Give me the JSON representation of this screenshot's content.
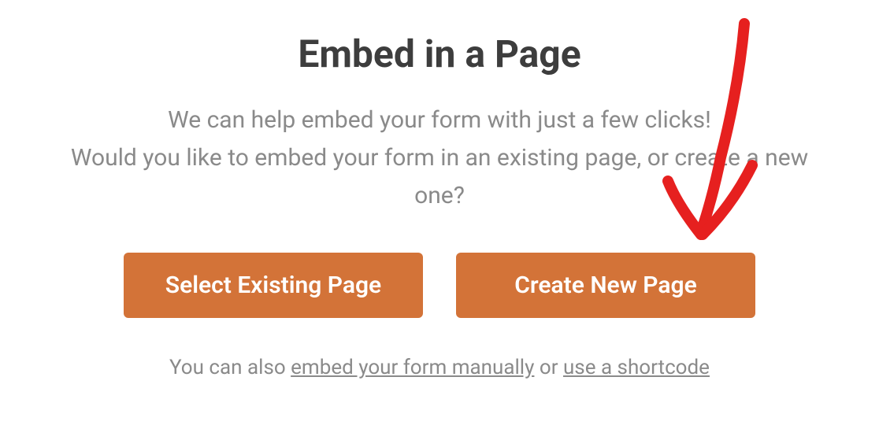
{
  "modal": {
    "title": "Embed in a Page",
    "description_line1": "We can help embed your form with just a few clicks!",
    "description_line2": "Would you like to embed your form in an existing page, or create a new one?",
    "buttons": {
      "select_existing_label": "Select Existing Page",
      "create_new_label": "Create New Page"
    },
    "footer": {
      "prefix": "You can also ",
      "link1": "embed your form manually",
      "separator": " or ",
      "link2": "use a shortcode"
    }
  },
  "colors": {
    "accent": "#d37338",
    "title": "#3d3d3d",
    "muted": "#8a8a8a",
    "annotation": "#e6201f"
  }
}
